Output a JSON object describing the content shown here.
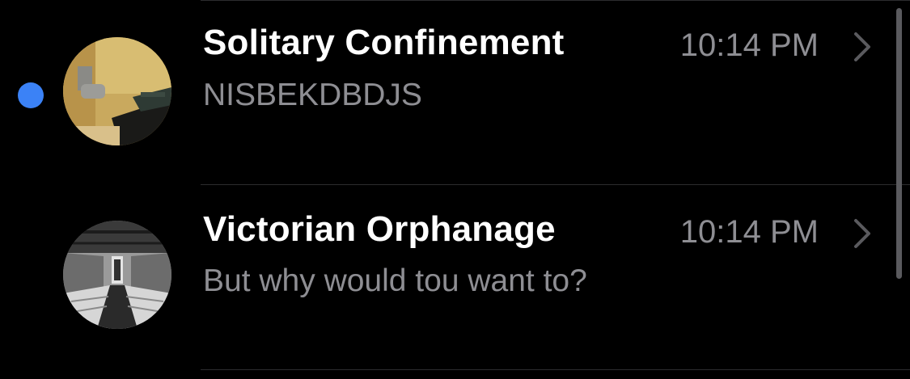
{
  "conversations": [
    {
      "name": "Solitary Confinement",
      "time": "10:14 PM",
      "preview": "NISBEKDBDJS",
      "unread": true
    },
    {
      "name": "Victorian Orphanage",
      "time": "10:14 PM",
      "preview": "But why would tou want to?",
      "unread": false
    }
  ],
  "icons": {
    "unread": "unread-dot",
    "disclosure": "chevron-right-icon"
  },
  "colors": {
    "background": "#000000",
    "unread_dot": "#3b82f6",
    "name_text": "#ffffff",
    "secondary_text": "#8e8e93"
  }
}
